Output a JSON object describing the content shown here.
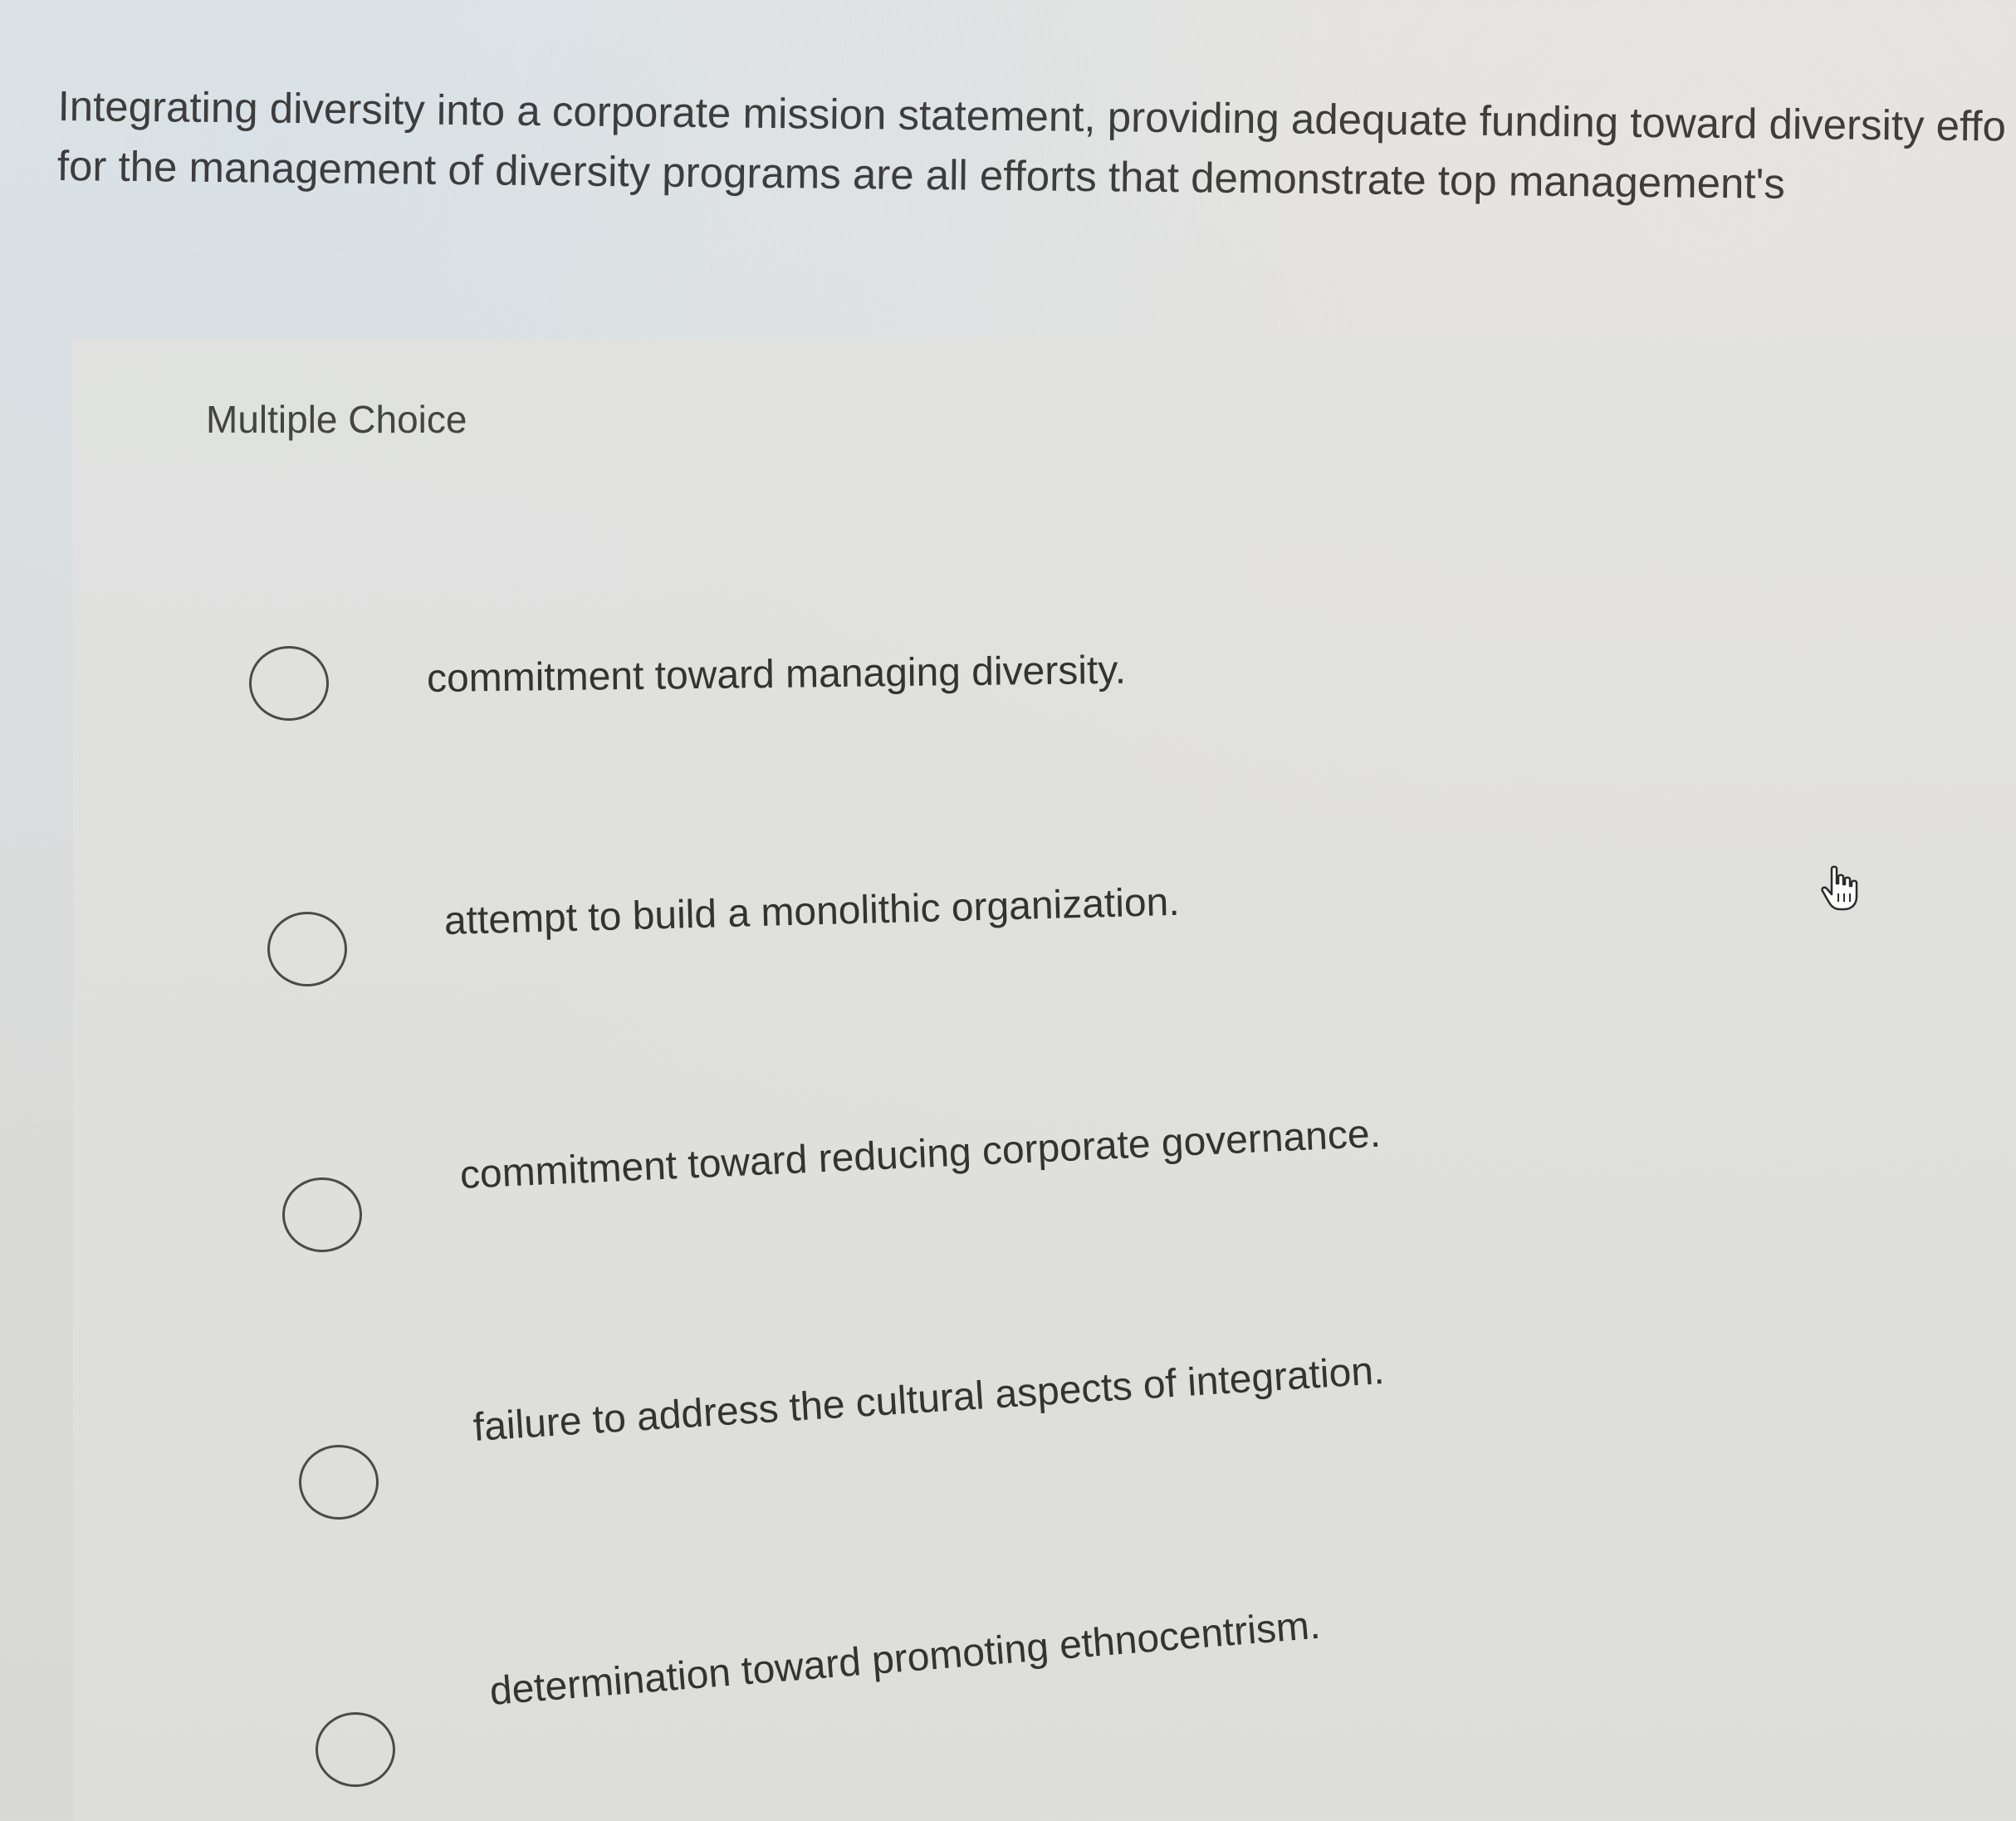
{
  "question": {
    "line1": "Integrating diversity into a corporate mission statement, providing adequate funding toward diversity effo",
    "line2": "for the management of diversity programs are all efforts that demonstrate top management's"
  },
  "multiple_choice": {
    "label": "Multiple Choice",
    "options": [
      {
        "text": "commitment toward managing diversity."
      },
      {
        "text": "attempt to build a monolithic organization."
      },
      {
        "text": "commitment toward reducing corporate governance."
      },
      {
        "text": "failure to address the cultural aspects of integration."
      },
      {
        "text": "determination toward promoting ethnocentrism."
      }
    ]
  },
  "cursor": {
    "icon": "hand-pointer-icon"
  }
}
